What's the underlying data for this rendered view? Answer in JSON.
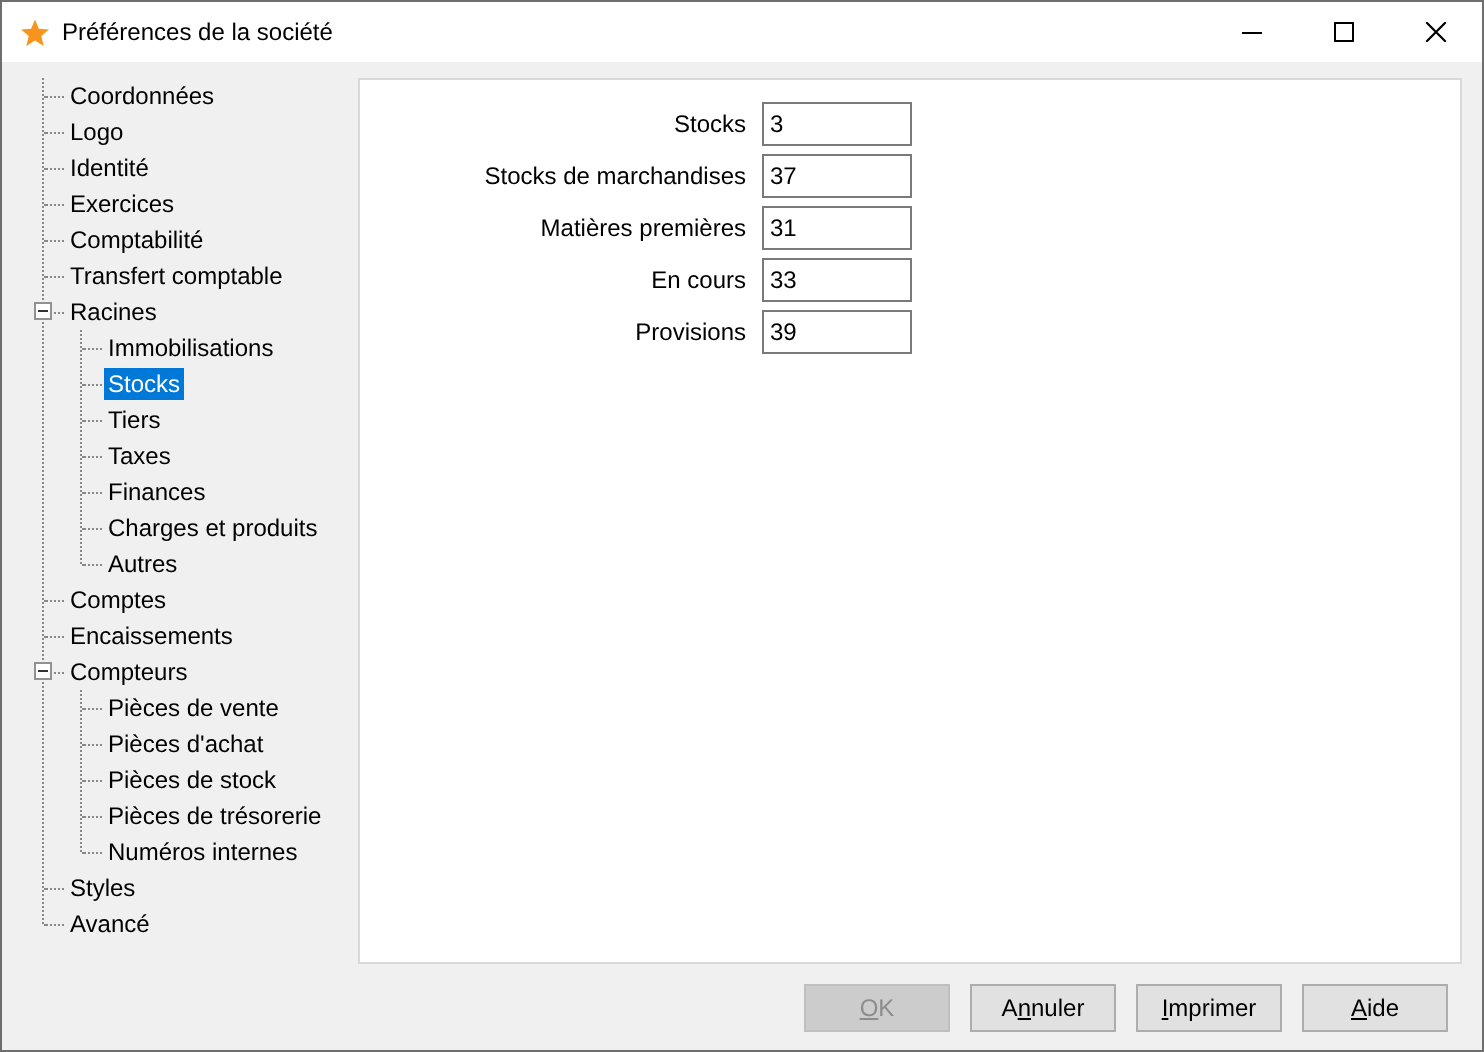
{
  "window": {
    "title": "Préférences de la société"
  },
  "tree": [
    {
      "label": "Coordonnées",
      "selected": false
    },
    {
      "label": "Logo",
      "selected": false
    },
    {
      "label": "Identité",
      "selected": false
    },
    {
      "label": "Exercices",
      "selected": false
    },
    {
      "label": "Comptabilité",
      "selected": false
    },
    {
      "label": "Transfert comptable",
      "selected": false
    },
    {
      "label": "Racines",
      "selected": false,
      "expanded": true,
      "children": [
        {
          "label": "Immobilisations",
          "selected": false
        },
        {
          "label": "Stocks",
          "selected": true
        },
        {
          "label": "Tiers",
          "selected": false
        },
        {
          "label": "Taxes",
          "selected": false
        },
        {
          "label": "Finances",
          "selected": false
        },
        {
          "label": "Charges et produits",
          "selected": false
        },
        {
          "label": "Autres",
          "selected": false
        }
      ]
    },
    {
      "label": "Comptes",
      "selected": false
    },
    {
      "label": "Encaissements",
      "selected": false
    },
    {
      "label": "Compteurs",
      "selected": false,
      "expanded": true,
      "children": [
        {
          "label": "Pièces de vente",
          "selected": false
        },
        {
          "label": "Pièces d'achat",
          "selected": false
        },
        {
          "label": "Pièces de stock",
          "selected": false
        },
        {
          "label": "Pièces de trésorerie",
          "selected": false
        },
        {
          "label": "Numéros internes",
          "selected": false
        }
      ]
    },
    {
      "label": "Styles",
      "selected": false
    },
    {
      "label": "Avancé",
      "selected": false
    }
  ],
  "fields": [
    {
      "label": "Stocks",
      "value": "3"
    },
    {
      "label": "Stocks de marchandises",
      "value": "37"
    },
    {
      "label": "Matières premières",
      "value": "31"
    },
    {
      "label": "En cours",
      "value": "33"
    },
    {
      "label": "Provisions",
      "value": "39"
    }
  ],
  "buttons": [
    {
      "key": "O",
      "after": "K",
      "disabled": true
    },
    {
      "before": "A",
      "key": "n",
      "after": "nuler",
      "disabled": false
    },
    {
      "key": "I",
      "after": "mprimer",
      "disabled": false
    },
    {
      "key": "A",
      "after": "ide",
      "disabled": false
    }
  ]
}
